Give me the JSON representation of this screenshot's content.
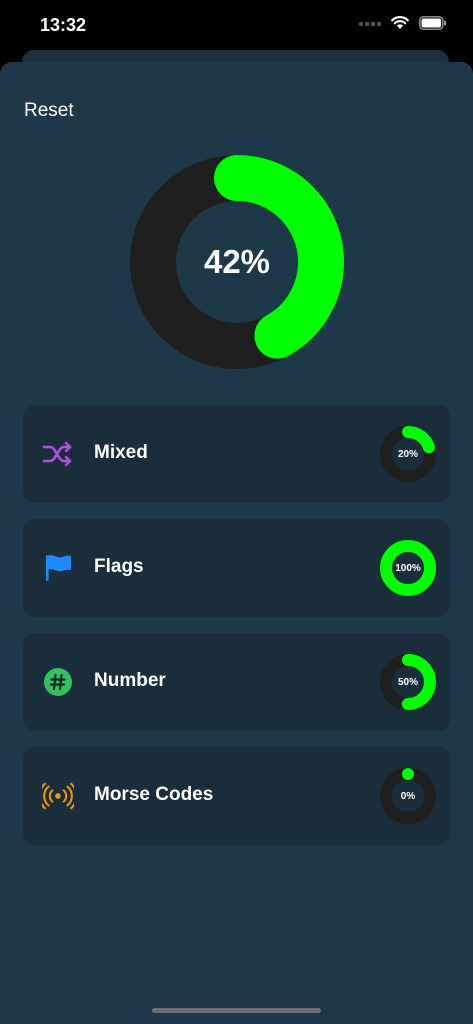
{
  "status_bar": {
    "time": "13:32"
  },
  "header": {
    "reset_label": "Reset"
  },
  "overall": {
    "percent_label": "42%",
    "progress": 0.42
  },
  "colors": {
    "progress": "#00ff00",
    "track": "#1e1e1e",
    "background": "#1c3849",
    "card": "#1a2d3a"
  },
  "categories": [
    {
      "label": "Mixed",
      "icon": "shuffle-icon",
      "icon_color": "#b04fe0",
      "percent_label": "20%",
      "progress": 0.2
    },
    {
      "label": "Flags",
      "icon": "flag-icon",
      "icon_color": "#1a8cff",
      "percent_label": "100%",
      "progress": 1.0
    },
    {
      "label": "Number",
      "icon": "number-icon",
      "icon_color": "#32c060",
      "percent_label": "50%",
      "progress": 0.5
    },
    {
      "label": "Morse Codes",
      "icon": "antenna-icon",
      "icon_color": "#f0960a",
      "percent_label": "0%",
      "progress": 0.0
    }
  ]
}
